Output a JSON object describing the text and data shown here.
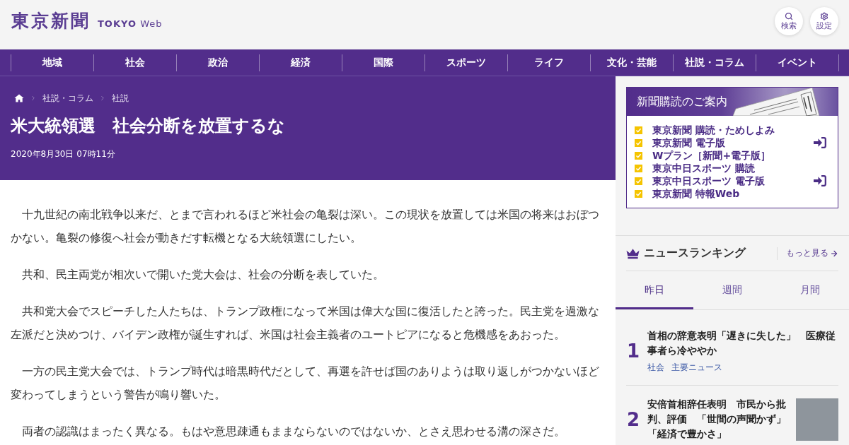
{
  "header": {
    "logo": {
      "wordmark": "東京新聞",
      "tagline": "**TOKYO** Web"
    },
    "buttons": [
      {
        "kind": "search",
        "label": "検索"
      },
      {
        "kind": "settings",
        "label": "設定"
      }
    ]
  },
  "nav": {
    "items": [
      "地域",
      "社会",
      "政治",
      "経済",
      "国際",
      "スポーツ",
      "ライフ",
      "文化・芸能",
      "社説・コラム",
      "イベント"
    ]
  },
  "article": {
    "breadcrumb": [
      "社説・コラム",
      "社説"
    ],
    "title": "米大統領選　社会分断を放置するな",
    "date": "2020年8月30日 07時11分",
    "paragraphs": [
      "十九世紀の南北戦争以来だ、とまで言われるほど米社会の亀裂は深い。この現状を放置しては米国の将来はおぼつかない。亀裂の修復へ社会が動きだす転機となる大統領選にしたい。",
      "共和、民主両党が相次いで開いた党大会は、社会の分断を表していた。",
      "共和党大会でスピーチした人たちは、トランプ政権になって米国は偉大な国に復活したと誇った。民主党を過激な左派だと決めつけ、バイデン政権が誕生すれば、米国は社会主義者のユートピアになると危機感をあおった。",
      "一方の民主党大会では、トランプ時代は暗黒時代だとして、再選を許せば国のありようは取り返しがつかないほど変わってしまうという警告が鳴り響いた。",
      "両者の認識はまったく異なる。もはや意思疎通もままならないのではないか、とさえ思わせる溝の深さだ。"
    ]
  },
  "subscription": {
    "title": "新聞購読のご案内",
    "items": [
      {
        "label": "東京新聞 購読・ためしよみ",
        "login_icon": false
      },
      {
        "label": "東京新聞 電子版",
        "login_icon": true
      },
      {
        "label": "Wプラン［新聞+電子版］",
        "login_icon": false
      },
      {
        "label": "東京中日スポーツ 購読",
        "login_icon": false
      },
      {
        "label": "東京中日スポーツ 電子版",
        "login_icon": true
      },
      {
        "label": "東京新聞 特報Web",
        "login_icon": false
      }
    ]
  },
  "ranking": {
    "title": "ニュースランキング",
    "more_link": "もっと見る",
    "tabs": [
      {
        "label": "昨日",
        "selected": true
      },
      {
        "label": "週間",
        "selected": false
      },
      {
        "label": "月間",
        "selected": false
      }
    ],
    "items": [
      {
        "rank": "1",
        "title": "首相の辞意表明「遅きに失した」　医療従事者ら冷ややか",
        "tags": [
          "社会",
          "主要ニュース"
        ],
        "photo": false
      },
      {
        "rank": "2",
        "title": "安倍首相辞任表明　市民から批判、評価　「世間の声聞かず」「経済で豊かさ」",
        "photo": true
      }
    ]
  }
}
